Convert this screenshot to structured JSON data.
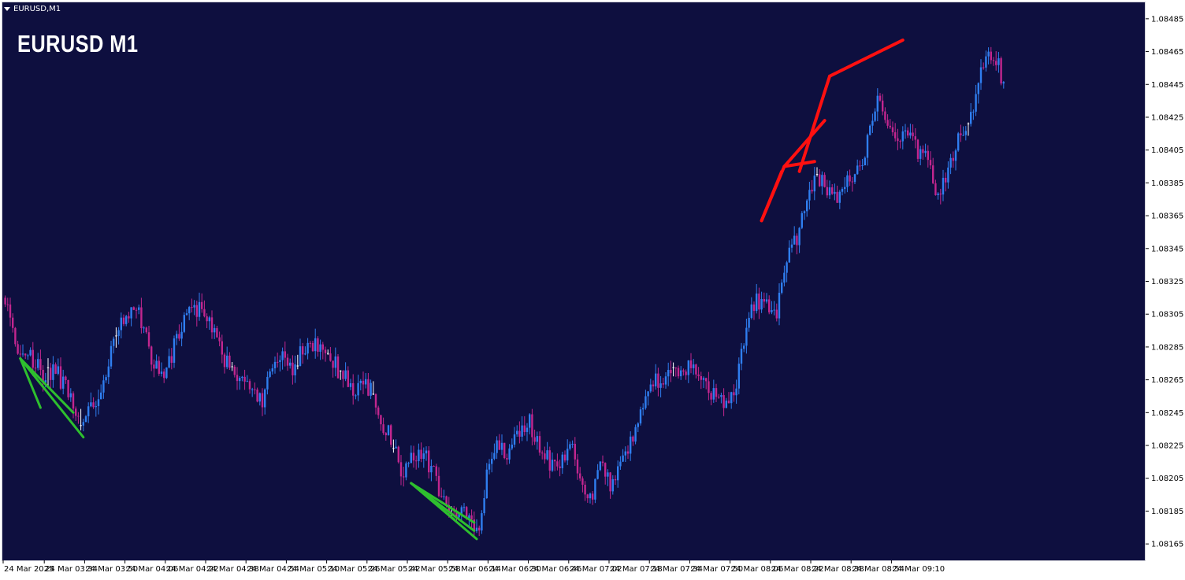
{
  "window": {
    "symbol_tab": "EURUSD,M1"
  },
  "chart_title": "EURUSD M1",
  "colors": {
    "background": "#0e0f3f",
    "bull_candle": "#2f7ef0",
    "bear_candle": "#c2268f",
    "doji_candle": "#ffffff",
    "low_swing_lines": "#2ebf2e",
    "high_swing_lines": "#ff1010",
    "axis_text": "#000000"
  },
  "chart_data": {
    "type": "candlestick",
    "symbol": "EURUSD",
    "timeframe": "M1",
    "title": "EURUSD M1",
    "ylim": [
      1.08155,
      1.08495
    ],
    "y_ticks": [
      "1.08485",
      "1.08465",
      "1.08445",
      "1.08425",
      "1.08405",
      "1.08385",
      "1.08365",
      "1.08345",
      "1.08325",
      "1.08305",
      "1.08285",
      "1.08265",
      "1.08245",
      "1.08225",
      "1.08205",
      "1.08185",
      "1.08165"
    ],
    "x_ticks": [
      "24 Mar 2025",
      "24 Mar 03:34",
      "24 Mar 03:50",
      "24 Mar 04:06",
      "24 Mar 04:22",
      "24 Mar 04:38",
      "24 Mar 04:54",
      "24 Mar 05:10",
      "24 Mar 05:26",
      "24 Mar 05:42",
      "24 Mar 05:58",
      "24 Mar 06:14",
      "24 Mar 06:30",
      "24 Mar 06:46",
      "24 Mar 07:02",
      "24 Mar 07:18",
      "24 Mar 07:34",
      "24 Mar 07:50",
      "24 Mar 08:06",
      "24 Mar 08:22",
      "24 Mar 08:38",
      "24 Mar 08:54",
      "24 Mar 09:10"
    ],
    "x_start": "24 Mar 03:18",
    "bar_minutes": 1,
    "bars_per_tick": 16,
    "close_path": [
      [
        0,
        1.08315
      ],
      [
        4,
        1.08288
      ],
      [
        10,
        1.0828
      ],
      [
        15,
        1.08268
      ],
      [
        20,
        1.0827
      ],
      [
        26,
        1.08255
      ],
      [
        31,
        1.0824
      ],
      [
        35,
        1.0825
      ],
      [
        40,
        1.0827
      ],
      [
        44,
        1.0829
      ],
      [
        48,
        1.08305
      ],
      [
        52,
        1.0831
      ],
      [
        55,
        1.08295
      ],
      [
        59,
        1.08275
      ],
      [
        63,
        1.08268
      ],
      [
        67,
        1.08285
      ],
      [
        70,
        1.083
      ],
      [
        74,
        1.08312
      ],
      [
        78,
        1.08305
      ],
      [
        82,
        1.08295
      ],
      [
        86,
        1.0828
      ],
      [
        90,
        1.0827
      ],
      [
        94,
        1.08262
      ],
      [
        98,
        1.08258
      ],
      [
        102,
        1.08252
      ],
      [
        106,
        1.08275
      ],
      [
        110,
        1.0828
      ],
      [
        114,
        1.08272
      ],
      [
        118,
        1.08283
      ],
      [
        124,
        1.08285
      ],
      [
        130,
        1.08275
      ],
      [
        134,
        1.08268
      ],
      [
        138,
        1.0826
      ],
      [
        142,
        1.08265
      ],
      [
        146,
        1.08255
      ],
      [
        150,
        1.08238
      ],
      [
        154,
        1.08225
      ],
      [
        158,
        1.08205
      ],
      [
        162,
        1.08218
      ],
      [
        166,
        1.0822
      ],
      [
        170,
        1.08208
      ],
      [
        174,
        1.08192
      ],
      [
        178,
        1.08185
      ],
      [
        182,
        1.08182
      ],
      [
        186,
        1.08172
      ],
      [
        188,
        1.08175
      ],
      [
        192,
        1.08215
      ],
      [
        196,
        1.08225
      ],
      [
        200,
        1.0822
      ],
      [
        205,
        1.08235
      ],
      [
        208,
        1.0824
      ],
      [
        212,
        1.0822
      ],
      [
        216,
        1.08215
      ],
      [
        220,
        1.08212
      ],
      [
        224,
        1.0823
      ],
      [
        228,
        1.08205
      ],
      [
        232,
        1.08192
      ],
      [
        236,
        1.08212
      ],
      [
        240,
        1.08202
      ],
      [
        244,
        1.0821
      ],
      [
        248,
        1.08228
      ],
      [
        252,
        1.08245
      ],
      [
        256,
        1.08265
      ],
      [
        260,
        1.08262
      ],
      [
        264,
        1.08273
      ],
      [
        268,
        1.08268
      ],
      [
        272,
        1.08272
      ],
      [
        276,
        1.08262
      ],
      [
        280,
        1.08258
      ],
      [
        285,
        1.08252
      ],
      [
        290,
        1.08262
      ],
      [
        294,
        1.083
      ],
      [
        298,
        1.08312
      ],
      [
        302,
        1.0831
      ],
      [
        306,
        1.08308
      ],
      [
        310,
        1.0834
      ],
      [
        314,
        1.08352
      ],
      [
        318,
        1.0838
      ],
      [
        322,
        1.08388
      ],
      [
        326,
        1.0838
      ],
      [
        330,
        1.08375
      ],
      [
        334,
        1.08385
      ],
      [
        338,
        1.0839
      ],
      [
        342,
        1.0841
      ],
      [
        346,
        1.08438
      ],
      [
        350,
        1.0842
      ],
      [
        354,
        1.08408
      ],
      [
        358,
        1.08415
      ],
      [
        362,
        1.08405
      ],
      [
        366,
        1.08398
      ],
      [
        370,
        1.08378
      ],
      [
        374,
        1.08395
      ],
      [
        378,
        1.0841
      ],
      [
        382,
        1.0842
      ],
      [
        386,
        1.08448
      ],
      [
        390,
        1.08465
      ],
      [
        394,
        1.08455
      ],
      [
        396,
        1.08448
      ]
    ],
    "dojis": [
      17,
      30,
      44,
      90,
      116,
      128,
      133,
      146,
      154,
      177,
      265,
      322,
      382
    ],
    "annotations": {
      "green_lines": [
        [
          [
            6,
            1.08278
          ],
          [
            14,
            1.08248
          ]
        ],
        [
          [
            6,
            1.08278
          ],
          [
            27,
            1.08245
          ]
        ],
        [
          [
            6,
            1.08278
          ],
          [
            31,
            1.0823
          ]
        ],
        [
          [
            161,
            1.08202
          ],
          [
            186,
            1.08178
          ]
        ],
        [
          [
            161,
            1.08202
          ],
          [
            186,
            1.08173
          ]
        ],
        [
          [
            161,
            1.08202
          ],
          [
            178,
            1.0818
          ]
        ],
        [
          [
            161,
            1.08202
          ],
          [
            187,
            1.08168
          ]
        ]
      ],
      "red_lines": [
        [
          [
            300,
            1.08362
          ],
          [
            308,
            1.08392
          ]
        ],
        [
          [
            300,
            1.08362
          ],
          [
            309,
            1.08395
          ]
        ],
        [
          [
            309,
            1.08395
          ],
          [
            321,
            1.08398
          ]
        ],
        [
          [
            309,
            1.08395
          ],
          [
            325,
            1.08423
          ]
        ],
        [
          [
            315,
            1.08392
          ],
          [
            327,
            1.0845
          ]
        ],
        [
          [
            327,
            1.0845
          ],
          [
            356,
            1.08472
          ]
        ]
      ]
    }
  }
}
